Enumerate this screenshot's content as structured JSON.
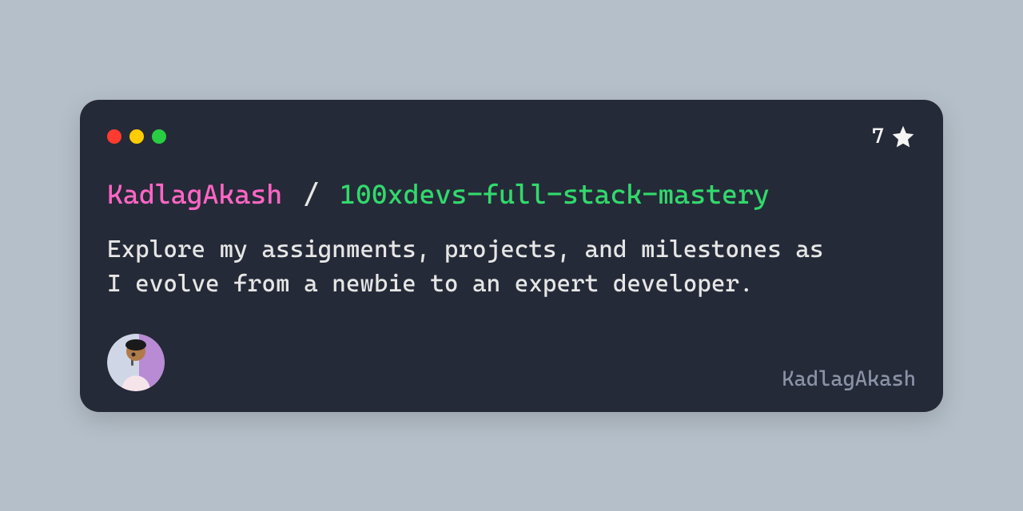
{
  "colors": {
    "background": "#b5bfc9",
    "card": "#252a38",
    "owner": "#ff66c4",
    "repo": "#32d96c",
    "text": "#e6e6e6",
    "muted": "#8a93a6"
  },
  "trafficLights": [
    "red",
    "yellow",
    "green"
  ],
  "stars": {
    "count": "7",
    "icon": "star-icon"
  },
  "title": {
    "owner": "KadlagAkash",
    "separator": "/",
    "repo": "100xdevs-full-stack-mastery"
  },
  "description": "Explore my assignments, projects, and milestones as I evolve from a newbie to an expert developer.",
  "footer": {
    "author": "KadlagAkash",
    "avatar": "avatar"
  }
}
